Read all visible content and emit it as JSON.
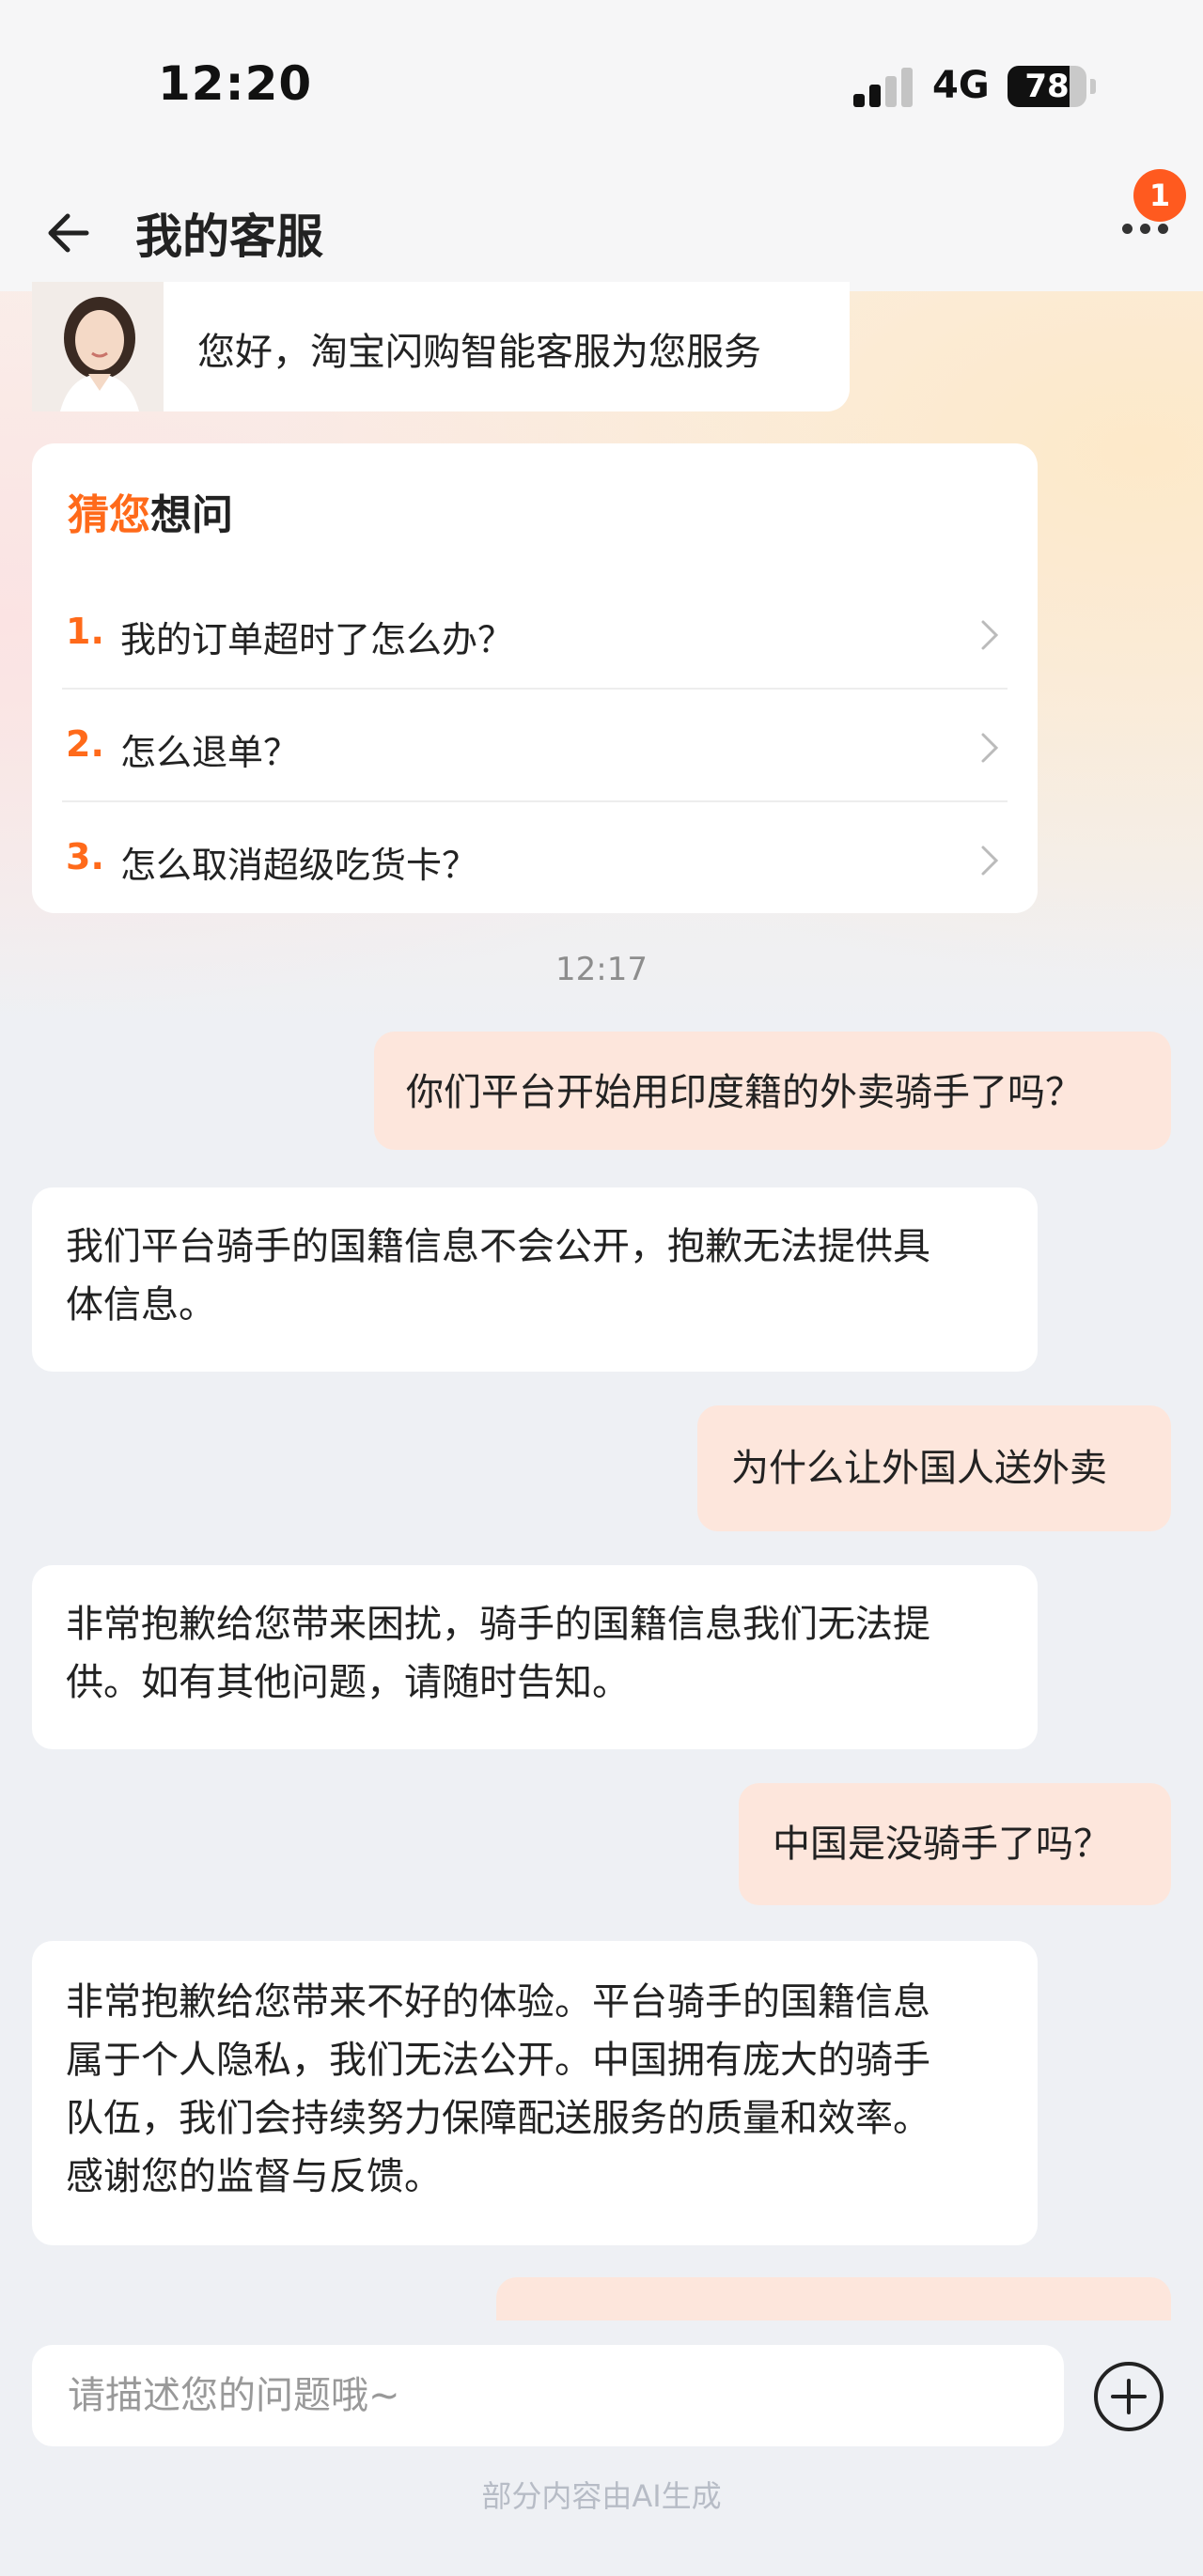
{
  "status_bar": {
    "time": "12:20",
    "network": "4G",
    "battery": "78",
    "battery_level": 0.78
  },
  "header": {
    "title": "我的客服",
    "back_icon": "arrow-left-icon",
    "more_icon": "more-dots-icon",
    "notification_badge": "1"
  },
  "greeting": {
    "text": "您好，淘宝闪购智能客服为您服务"
  },
  "suggestions": {
    "title_highlight": "猜您",
    "title_rest": "想问",
    "items": [
      {
        "num": "1.",
        "text": "我的订单超时了怎么办？"
      },
      {
        "num": "2.",
        "text": "怎么退单？"
      },
      {
        "num": "3.",
        "text": "怎么取消超级吃货卡？"
      }
    ]
  },
  "timestamp": "12:17",
  "messages": [
    {
      "role": "user",
      "lines": [
        "你们平台开始用印度籍的外卖骑手了吗？"
      ]
    },
    {
      "role": "bot",
      "lines": [
        "我们平台骑手的国籍信息不会公开，抱歉无法提供具",
        "体信息。"
      ]
    },
    {
      "role": "user",
      "lines": [
        "为什么让外国人送外卖"
      ]
    },
    {
      "role": "bot",
      "lines": [
        "非常抱歉给您带来困扰，骑手的国籍信息我们无法提",
        "供。如有其他问题，请随时告知。"
      ]
    },
    {
      "role": "user",
      "lines": [
        "中国是没骑手了吗？"
      ]
    },
    {
      "role": "bot",
      "lines": [
        "非常抱歉给您带来不好的体验。平台骑手的国籍信息",
        "属于个人隐私，我们无法公开。中国拥有庞大的骑手",
        "队伍，我们会持续努力保障配送服务的质量和效率。",
        "感谢您的监督与反馈。"
      ]
    }
  ],
  "input": {
    "placeholder": "请描述您的问题哦~"
  },
  "footer": {
    "note": "部分内容由AI生成"
  },
  "colors": {
    "accent": "#ff6a1a",
    "user_bubble": "#fde6dc",
    "bot_bubble": "#ffffff"
  }
}
